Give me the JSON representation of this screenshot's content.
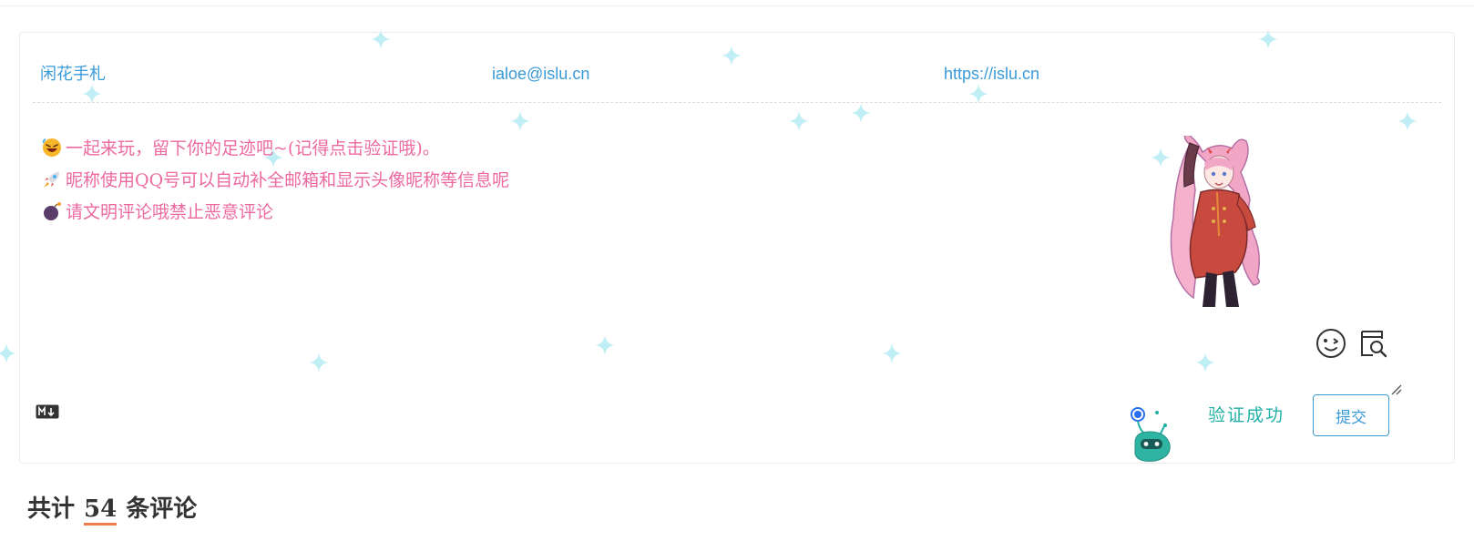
{
  "form": {
    "nick_placeholder": "闲花手札",
    "mail_placeholder": "ialoe@islu.cn",
    "link_placeholder": "https://islu.cn"
  },
  "editor": {
    "tips": [
      {
        "icon": "rofl-emoji-icon",
        "text": "一起来玩，留下你的足迹吧~(记得点击验证哦)。"
      },
      {
        "icon": "rocket-emoji-icon",
        "text": "昵称使用QQ号可以自动补全邮箱和显示头像昵称等信息呢"
      },
      {
        "icon": "bomb-emoji-icon",
        "text": "请文明评论哦禁止恶意评论"
      }
    ]
  },
  "toolbar": {
    "emoji_icon": "wink-face-icon",
    "preview_icon": "preview-search-icon",
    "markdown_icon": "markdown-icon"
  },
  "captcha": {
    "status_text": "验证成功",
    "robot_icon": "captcha-robot-icon"
  },
  "submit": {
    "label": "提交"
  },
  "comments": {
    "prefix": "共计",
    "count": "54",
    "suffix": "条评论"
  },
  "colors": {
    "accent_blue": "#3a9bd8",
    "tip_pink": "#ec6aa0",
    "verify_teal": "#23b0a8",
    "count_underline": "#f07b4e",
    "sparkle": "#bfeff5"
  }
}
